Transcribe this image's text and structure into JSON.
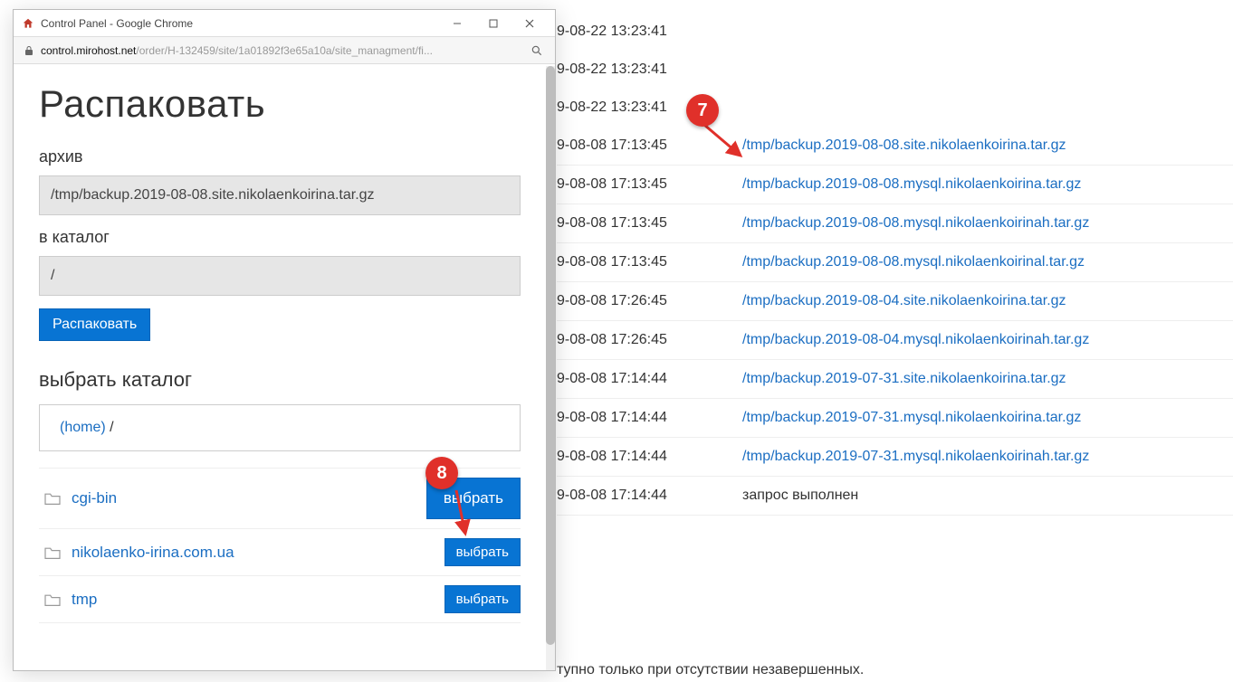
{
  "popup": {
    "window_title": "Control Panel - Google Chrome",
    "url_host": "control.mirohost.net",
    "url_path": "/order/H-132459/site/1a01892f3e65a10a/site_managment/fi...",
    "heading": "Распаковать",
    "archive_label": "архив",
    "archive_value": "/tmp/backup.2019-08-08.site.nikolaenkoirina.tar.gz",
    "catalog_label": "в каталог",
    "catalog_value": "/",
    "submit_label": "Распаковать",
    "choose_catalog_heading": "выбрать каталог",
    "breadcrumb_home": "(home)",
    "breadcrumb_sep": " /",
    "select_label": "выбрать",
    "folders": [
      {
        "name": "cgi-bin"
      },
      {
        "name": "nikolaenko-irina.com.ua"
      },
      {
        "name": "tmp"
      }
    ]
  },
  "bg": {
    "rows": [
      {
        "time": "9-08-22 13:23:41",
        "link": "",
        "text": ""
      },
      {
        "time": "9-08-22 13:23:41",
        "link": "",
        "text": ""
      },
      {
        "time": "9-08-22 13:23:41",
        "link": "",
        "text": ""
      },
      {
        "time": "9-08-08 17:13:45",
        "link": "/tmp/backup.2019-08-08.site.nikolaenkoirina.tar.gz",
        "text": ""
      },
      {
        "time": "9-08-08 17:13:45",
        "link": "/tmp/backup.2019-08-08.mysql.nikolaenkoirina.tar.gz",
        "text": ""
      },
      {
        "time": "9-08-08 17:13:45",
        "link": "/tmp/backup.2019-08-08.mysql.nikolaenkoirinah.tar.gz",
        "text": ""
      },
      {
        "time": "9-08-08 17:13:45",
        "link": "/tmp/backup.2019-08-08.mysql.nikolaenkoirinal.tar.gz",
        "text": ""
      },
      {
        "time": "9-08-08 17:26:45",
        "link": "/tmp/backup.2019-08-04.site.nikolaenkoirina.tar.gz",
        "text": ""
      },
      {
        "time": "9-08-08 17:26:45",
        "link": "/tmp/backup.2019-08-04.mysql.nikolaenkoirinah.tar.gz",
        "text": ""
      },
      {
        "time": "9-08-08 17:14:44",
        "link": "/tmp/backup.2019-07-31.site.nikolaenkoirina.tar.gz",
        "text": ""
      },
      {
        "time": "9-08-08 17:14:44",
        "link": "/tmp/backup.2019-07-31.mysql.nikolaenkoirina.tar.gz",
        "text": ""
      },
      {
        "time": "9-08-08 17:14:44",
        "link": "/tmp/backup.2019-07-31.mysql.nikolaenkoirinah.tar.gz",
        "text": ""
      },
      {
        "time": "9-08-08 17:14:44",
        "link": "",
        "text": "запрос выполнен"
      }
    ],
    "footer": "тупно только при отсутствии незавершенных."
  },
  "markers": {
    "m7": "7",
    "m8": "8"
  }
}
